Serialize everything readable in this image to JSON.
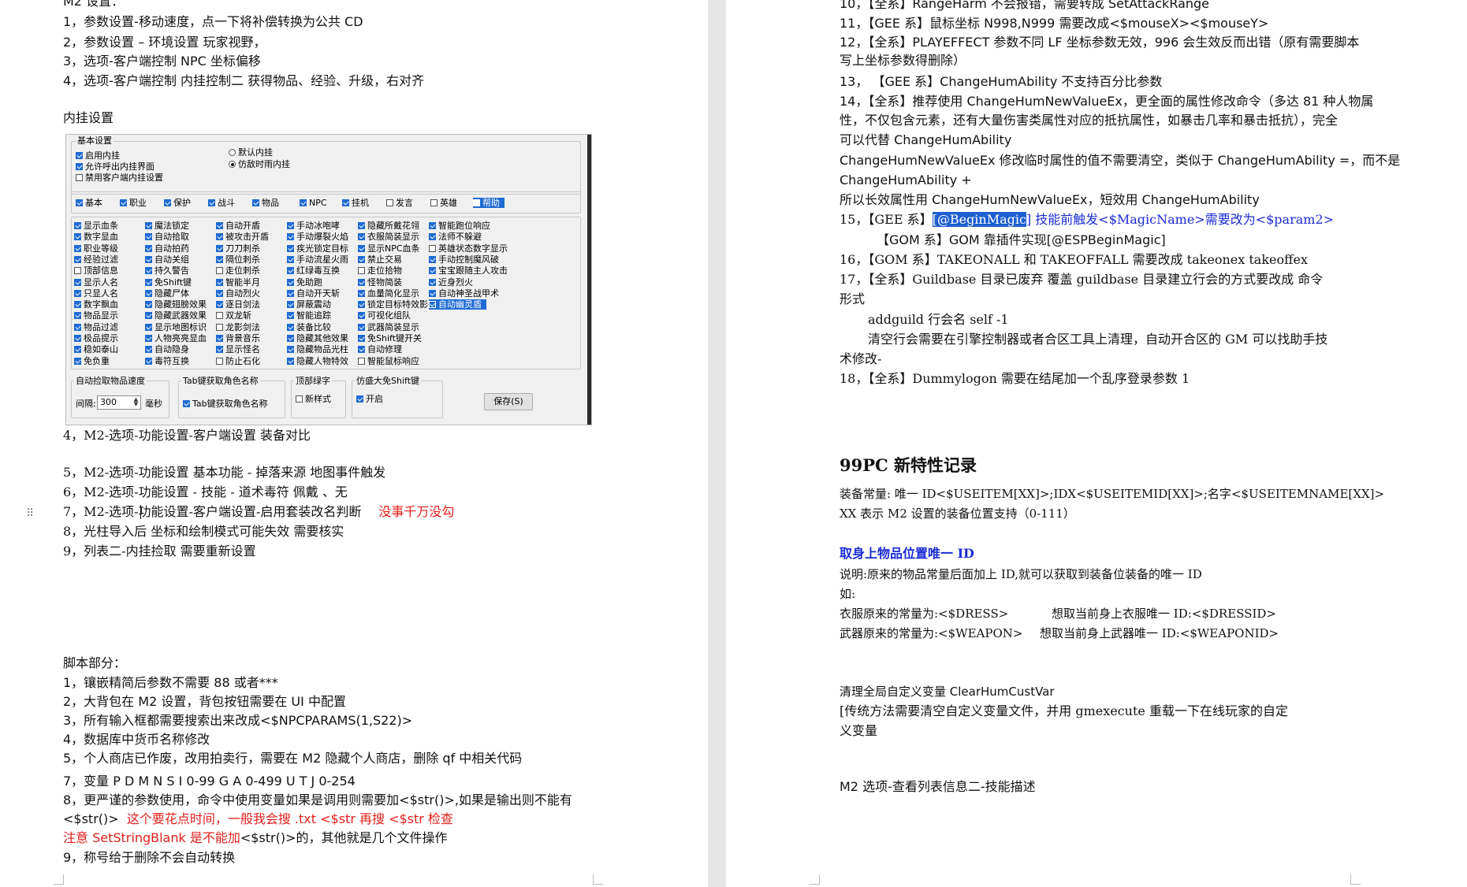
{
  "left": {
    "top_partial": "M2 设置：",
    "m2_items": [
      "1，参数设置-移动速度，点一下将补偿转换为公共 CD",
      "2，参数设置 – 环境设置   玩家视野，",
      "3，选项-客户端控制 NPC 坐标偏移",
      "4，选项-客户端控制 内挂控制二 获得物品、经验、升级，右对齐"
    ],
    "plugin_heading": "内挂设置",
    "panel": {
      "basic_group": "基本设置",
      "enable_plugin": "启用内挂",
      "allow_call": "允许呼出内挂界面",
      "disable_client": "禁用客户端内挂设置",
      "radio_default": "默认内挂",
      "radio_sim": "仿敌时雨内挂",
      "tabs": [
        {
          "label": "基本",
          "on": true
        },
        {
          "label": "职业",
          "on": true
        },
        {
          "label": "保护",
          "on": true
        },
        {
          "label": "战斗",
          "on": true
        },
        {
          "label": "物品",
          "on": true
        },
        {
          "label": "NPC",
          "on": true
        },
        {
          "label": "挂机",
          "on": true
        },
        {
          "label": "发言",
          "on": false
        },
        {
          "label": "英雄",
          "on": false
        },
        {
          "label": "帮助",
          "on": false,
          "hl": true
        }
      ],
      "columns": [
        [
          {
            "label": "显示血条",
            "on": true
          },
          {
            "label": "数字显血",
            "on": true
          },
          {
            "label": "职业等级",
            "on": true
          },
          {
            "label": "经验过滤",
            "on": true
          },
          {
            "label": "顶部信息",
            "on": false
          },
          {
            "label": "显示人名",
            "on": true
          },
          {
            "label": "只显人名",
            "on": true
          },
          {
            "label": "数字飘血",
            "on": true
          },
          {
            "label": "物品显示",
            "on": true
          },
          {
            "label": "物品过滤",
            "on": true
          },
          {
            "label": "极品提示",
            "on": true
          },
          {
            "label": "稳如泰山",
            "on": true
          },
          {
            "label": "免负重",
            "on": true
          }
        ],
        [
          {
            "label": "魔法锁定",
            "on": true
          },
          {
            "label": "自动拾取",
            "on": true
          },
          {
            "label": "自动拍药",
            "on": true
          },
          {
            "label": "自动关组",
            "on": true
          },
          {
            "label": "持久警告",
            "on": true
          },
          {
            "label": "免Shift键",
            "on": true
          },
          {
            "label": "隐藏尸体",
            "on": true
          },
          {
            "label": "隐藏翅膀效果",
            "on": true
          },
          {
            "label": "隐藏武器效果",
            "on": true
          },
          {
            "label": "显示地图标识",
            "on": true
          },
          {
            "label": "人物亮亮显血",
            "on": true
          },
          {
            "label": "自动隐身",
            "on": true
          },
          {
            "label": "毒符互换",
            "on": true
          }
        ],
        [
          {
            "label": "自动开盾",
            "on": true
          },
          {
            "label": "被攻击开盾",
            "on": true
          },
          {
            "label": "刀刀刺杀",
            "on": true
          },
          {
            "label": "隔位刺杀",
            "on": true
          },
          {
            "label": "走位刺杀",
            "on": false
          },
          {
            "label": "智能半月",
            "on": true
          },
          {
            "label": "自动烈火",
            "on": true
          },
          {
            "label": "逐日剑法",
            "on": true
          },
          {
            "label": "双龙斩",
            "on": false
          },
          {
            "label": "龙影剑法",
            "on": false
          },
          {
            "label": "背景音乐",
            "on": true
          },
          {
            "label": "显示怪名",
            "on": true
          },
          {
            "label": "防止石化",
            "on": false
          }
        ],
        [
          {
            "label": "手动冰咆哮",
            "on": true
          },
          {
            "label": "手动爆裂火焰",
            "on": true
          },
          {
            "label": "疾光锁定目标",
            "on": true
          },
          {
            "label": "手动流星火雨",
            "on": true
          },
          {
            "label": "红绿毒互换",
            "on": true
          },
          {
            "label": "免助跑",
            "on": true
          },
          {
            "label": "自动开天斩",
            "on": true
          },
          {
            "label": "屏蔽震动",
            "on": true
          },
          {
            "label": "智能追踪",
            "on": true
          },
          {
            "label": "装备比较",
            "on": true
          },
          {
            "label": "隐藏其他效果",
            "on": true
          },
          {
            "label": "隐藏物品光柱",
            "on": true
          },
          {
            "label": "隐藏人物特效",
            "on": true
          }
        ],
        [
          {
            "label": "隐藏所戴花翎",
            "on": true
          },
          {
            "label": "衣服简装显示",
            "on": true
          },
          {
            "label": "显示NPC血条",
            "on": true
          },
          {
            "label": "禁止交易",
            "on": true
          },
          {
            "label": "走位拾物",
            "on": false
          },
          {
            "label": "怪物简装",
            "on": true
          },
          {
            "label": "血量简化显示",
            "on": true
          },
          {
            "label": "锁定目标特效影子",
            "on": true
          },
          {
            "label": "可视化组队",
            "on": true
          },
          {
            "label": "武器简装显示",
            "on": true
          },
          {
            "label": "免Shift键开关",
            "on": true
          },
          {
            "label": "自动修理",
            "on": true
          },
          {
            "label": "智能鼠标响应",
            "on": false
          }
        ],
        [
          {
            "label": "智能跑位响应",
            "on": true
          },
          {
            "label": "法师不躲避",
            "on": true
          },
          {
            "label": "英雄状态数字显示",
            "on": false
          },
          {
            "label": "手动控制魔风破",
            "on": true
          },
          {
            "label": "宝宝跟随主人攻击",
            "on": true
          },
          {
            "label": "近身烈火",
            "on": true
          },
          {
            "label": "自动神圣战甲术",
            "on": true
          },
          {
            "label": "自动幽灵盾",
            "on": true,
            "hl": true
          }
        ]
      ],
      "pickup_group": "自动捡取物品速度",
      "interval_label": "间隔:",
      "interval_value": "300",
      "ms_label": "毫秒",
      "tab_group": "Tab键获取角色名称",
      "tab_check": "Tab键获取角色名称",
      "top_group": "顶部绿字",
      "top_check": "新样式",
      "shift_group": "仿盛大免Shift键",
      "shift_check": "开启",
      "save_button": "保存(S)"
    },
    "feature_items": [
      "4，M2-选项-功能设置-客户端设置 装备对比",
      "5，M2-选项-功能设置 基本功能 - 掉落来源 地图事件触发",
      "6，M2-选项-功能设置 - 技能 - 道术毒符 佩戴 、无",
      "8，光柱导入后 坐标和绘制模式可能失效 需要核实",
      "9，列表二-内挂捡取 需要重新设置"
    ],
    "item7_main": "7，M2-选项-功能设置-客户端设置-启用套装改名判断",
    "item7_red": "没事千万没勾",
    "script_heading": "脚本部分：",
    "script_items": [
      "1，镶嵌精简后参数不需要 88 或者***",
      "2，大背包在 M2 设置，背包按钮需要在 UI 中配置",
      "3，所有输入框都需要搜索出来改成<$NPCPARAMS(1,S22)>",
      "4，数据库中货币名称修改",
      "5，个人商店已作废，改用拍卖行，需要在 M2 隐藏个人商店，删除 qf 中相关代码",
      "7，变量 P D M N S I 0-99       G A 0-499       U T J 0-254",
      "8，更严谨的参数使用，命令中使用变量如果是调用则需要加<$str()>,如果是输出则不能有"
    ],
    "script8_cont_a": "<$str()>",
    "script8_cont_red": "这个要花点时间，一般我会搜 .txt <$str        再搜  <$str  检查",
    "script8_note_red": "注意 SetStringBlank 是不能加",
    "script8_note_black": "<$str()>的，其他就是几个文件操作",
    "script9": "9，称号给于删除不会自动转换"
  },
  "right": {
    "items_top": [
      "10，【全系】RangeHarm 不会报错，需要转成 SetAttackRange",
      "11，【GEE 系】鼠标坐标 N998,N999 需要改成<$mouseX><$mouseY>",
      "12，【全系】PLAYEFFECT 参数不同 LF 坐标参数无效，996 会生效反而出错（原有需要脚本",
      "写上坐标参数得删除）",
      "13，  【GEE 系】ChangeHumAbility 不支持百分比参数",
      "14，【全系】推荐使用 ChangeHumNewValueEx，更全面的属性修改命令（多达 81 种人物属",
      "性，不仅包含元素，还有大量伤害类属性对应的抵抗属性，如暴击几率和暴击抵抗），完全",
      "可以代替 ChangeHumAbility",
      "ChangeHumNewValueEx 修改临时属性的值不需要清空，类似于 ChangeHumAbility =，而不是",
      "ChangeHumAbility +",
      "所以长效属性用 ChangeHumNewValueEx，短效用 ChangeHumAbility"
    ],
    "item15_pre": "15，【GEE 系】",
    "item15_sel": "[@BeginMagic",
    "item15_rest": "] 技能前触发<$MagicName>需要改为<$param2>",
    "item15b": "【GOM 系】GOM 靠插件实现[@ESPBeginMagic]",
    "item16": "16，【GOM 系】TAKEONALL 和 TAKEOFFALL 需要改成 takeonex  takeoffex",
    "item17": "17，【全系】Guildbase 目录已废弃 覆盖 guildbase 目录建立行会的方式要改成 命令",
    "item17b": "形式",
    "item17c": "addguild 行会名 self -1",
    "item17d": "清空行会需要在引擎控制器或者合区工具上清理，自动开合区的 GM 可以找助手技",
    "item17e": "术修改-",
    "item18": "18，【全系】Dummylogon 需要在结尾加一个乱序登录参数 1",
    "section_title": "99PC 新特性记录",
    "equip_line1": "装备常量: 唯一 ID<$USEITEM[XX]>;IDX<$USEITEMID[XX]>;名字<$USEITEMNAME[XX]>",
    "equip_line2": "XX 表示 M2 设置的装备位置支持（0-111）",
    "blue_heading": "取身上物品位置唯一 ID",
    "desc": "说明:原来的物品常量后面加上 ID,就可以获取到装备位装备的唯一 ID",
    "example": "如:",
    "dress_a": "衣服原来的常量为:<$DRESS>",
    "dress_b": "想取当前身上衣服唯一 ID:<$DRESSID>",
    "weapon_a": "武器原来的常量为:<$WEAPON>",
    "weapon_b": "想取当前身上武器唯一 ID:<$WEAPONID>",
    "clear_title": "清理全局自定义变量 ClearHumCustVar",
    "clear_line1": "[传统方法需要清空自定义变量文件，并用 gmexecute 重载一下在线玩家的自定",
    "clear_line2": "义变量",
    "m2_view": "M2 选项-查看列表信息二-技能描述"
  },
  "colors": {
    "red": "#e1201c",
    "blue": "#1a2bd6",
    "selection": "#1f5fd1",
    "checkbox": "#1f6bd3"
  },
  "icons": {
    "drag_handle": "drag-handle-icon"
  }
}
